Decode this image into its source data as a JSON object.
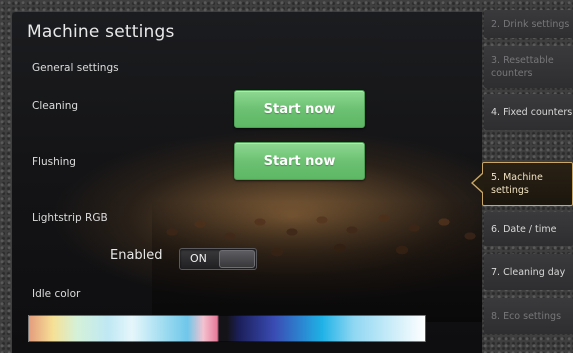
{
  "main": {
    "title": "Machine settings",
    "general_heading": "General settings",
    "cleaning": {
      "label": "Cleaning",
      "button": "Start now"
    },
    "flushing": {
      "label": "Flushing",
      "button": "Start now"
    },
    "lightstrip": {
      "label": "Lightstrip RGB",
      "enabled_label": "Enabled",
      "toggle_state": "ON"
    },
    "idle_color": {
      "label": "Idle color"
    }
  },
  "sidebar": {
    "items": [
      {
        "label": "2. Drink settings",
        "state": "dim"
      },
      {
        "label": "3. Resettable counters",
        "state": "dim"
      },
      {
        "label": "4. Fixed counters",
        "state": "normal"
      },
      {
        "label": "5. Machine settings",
        "state": "active"
      },
      {
        "label": "6. Date / time",
        "state": "normal"
      },
      {
        "label": "7. Cleaning day",
        "state": "normal"
      },
      {
        "label": "8. Eco settings",
        "state": "dim"
      }
    ]
  },
  "colors": {
    "button_green": "#6cc172",
    "active_border": "#caa765"
  }
}
